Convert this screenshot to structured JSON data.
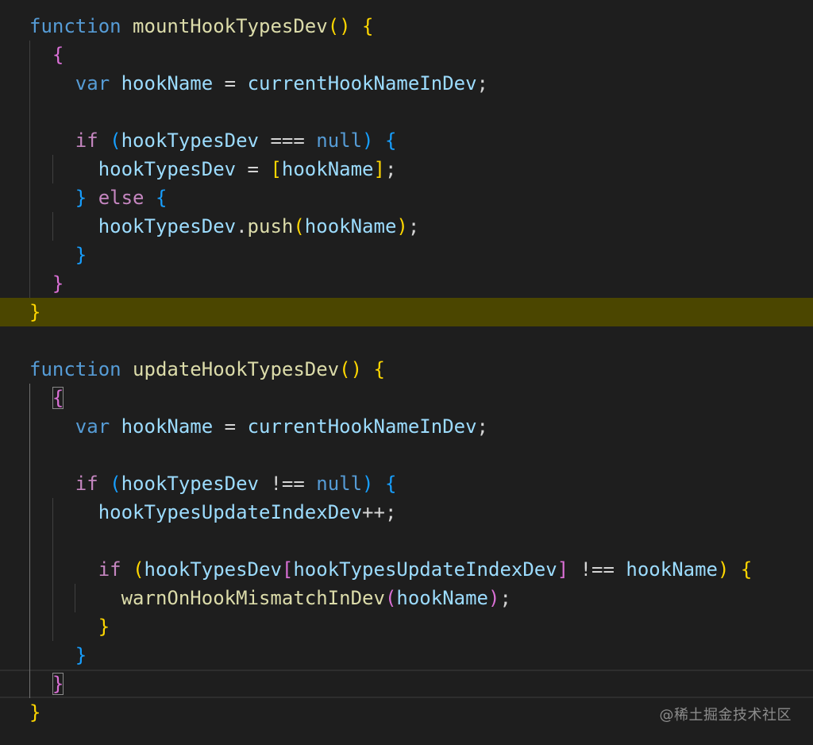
{
  "editor": {
    "colors": {
      "background": "#1e1e1e",
      "line_highlight": "#4b4600",
      "keyword": "#569cd6",
      "control": "#c586c0",
      "function": "#dcdcaa",
      "variable": "#9cdcfe",
      "bracket_gold": "#ffd700",
      "bracket_orchid": "#da70d6",
      "bracket_blue": "#179fff"
    },
    "lines": [
      {
        "tokens": [
          [
            "function",
            "kw"
          ],
          [
            " ",
            "op"
          ],
          [
            "mountHookTypesDev",
            "fn"
          ],
          [
            "()",
            "y"
          ],
          [
            " ",
            "op"
          ],
          [
            "{",
            "y"
          ]
        ]
      },
      {
        "tokens": [
          [
            "  ",
            "op"
          ],
          [
            "{",
            "p"
          ]
        ]
      },
      {
        "tokens": [
          [
            "    ",
            "op"
          ],
          [
            "var",
            "kw"
          ],
          [
            " ",
            "op"
          ],
          [
            "hookName",
            "var"
          ],
          [
            " = ",
            "op"
          ],
          [
            "currentHookNameInDev",
            "var"
          ],
          [
            ";",
            "op"
          ]
        ]
      },
      {
        "tokens": []
      },
      {
        "tokens": [
          [
            "    ",
            "op"
          ],
          [
            "if",
            "ctl"
          ],
          [
            " ",
            "op"
          ],
          [
            "(",
            "b"
          ],
          [
            "hookTypesDev",
            "var"
          ],
          [
            " === ",
            "op"
          ],
          [
            "null",
            "kw"
          ],
          [
            ")",
            "b"
          ],
          [
            " ",
            "op"
          ],
          [
            "{",
            "b"
          ]
        ]
      },
      {
        "tokens": [
          [
            "      ",
            "op"
          ],
          [
            "hookTypesDev",
            "var"
          ],
          [
            " = ",
            "op"
          ],
          [
            "[",
            "y"
          ],
          [
            "hookName",
            "var"
          ],
          [
            "]",
            "y"
          ],
          [
            ";",
            "op"
          ]
        ]
      },
      {
        "tokens": [
          [
            "    ",
            "op"
          ],
          [
            "}",
            "b"
          ],
          [
            " ",
            "op"
          ],
          [
            "else",
            "ctl"
          ],
          [
            " ",
            "op"
          ],
          [
            "{",
            "b"
          ]
        ]
      },
      {
        "tokens": [
          [
            "      ",
            "op"
          ],
          [
            "hookTypesDev",
            "var"
          ],
          [
            ".",
            "op"
          ],
          [
            "push",
            "fn"
          ],
          [
            "(",
            "y"
          ],
          [
            "hookName",
            "var"
          ],
          [
            ")",
            "y"
          ],
          [
            ";",
            "op"
          ]
        ]
      },
      {
        "tokens": [
          [
            "    ",
            "op"
          ],
          [
            "}",
            "b"
          ]
        ]
      },
      {
        "tokens": [
          [
            "  ",
            "op"
          ],
          [
            "}",
            "p"
          ]
        ]
      },
      {
        "tokens": [
          [
            "}",
            "y"
          ]
        ],
        "highlight": true
      },
      {
        "tokens": []
      },
      {
        "tokens": [
          [
            "function",
            "kw"
          ],
          [
            " ",
            "op"
          ],
          [
            "updateHookTypesDev",
            "fn"
          ],
          [
            "()",
            "y"
          ],
          [
            " ",
            "op"
          ],
          [
            "{",
            "y"
          ]
        ]
      },
      {
        "tokens": [
          [
            "  ",
            "op"
          ],
          [
            "{",
            "p",
            true
          ]
        ]
      },
      {
        "tokens": [
          [
            "    ",
            "op"
          ],
          [
            "var",
            "kw"
          ],
          [
            " ",
            "op"
          ],
          [
            "hookName",
            "var"
          ],
          [
            " = ",
            "op"
          ],
          [
            "currentHookNameInDev",
            "var"
          ],
          [
            ";",
            "op"
          ]
        ]
      },
      {
        "tokens": []
      },
      {
        "tokens": [
          [
            "    ",
            "op"
          ],
          [
            "if",
            "ctl"
          ],
          [
            " ",
            "op"
          ],
          [
            "(",
            "b"
          ],
          [
            "hookTypesDev",
            "var"
          ],
          [
            " !== ",
            "op"
          ],
          [
            "null",
            "kw"
          ],
          [
            ")",
            "b"
          ],
          [
            " ",
            "op"
          ],
          [
            "{",
            "b"
          ]
        ]
      },
      {
        "tokens": [
          [
            "      ",
            "op"
          ],
          [
            "hookTypesUpdateIndexDev",
            "var"
          ],
          [
            "++;",
            "op"
          ]
        ]
      },
      {
        "tokens": []
      },
      {
        "tokens": [
          [
            "      ",
            "op"
          ],
          [
            "if",
            "ctl"
          ],
          [
            " ",
            "op"
          ],
          [
            "(",
            "y"
          ],
          [
            "hookTypesDev",
            "var"
          ],
          [
            "[",
            "p"
          ],
          [
            "hookTypesUpdateIndexDev",
            "var"
          ],
          [
            "]",
            "p"
          ],
          [
            " !== ",
            "op"
          ],
          [
            "hookName",
            "var"
          ],
          [
            ")",
            "y"
          ],
          [
            " ",
            "op"
          ],
          [
            "{",
            "y"
          ]
        ]
      },
      {
        "tokens": [
          [
            "        ",
            "op"
          ],
          [
            "warnOnHookMismatchInDev",
            "fn"
          ],
          [
            "(",
            "p"
          ],
          [
            "hookName",
            "var"
          ],
          [
            ")",
            "p"
          ],
          [
            ";",
            "op"
          ]
        ]
      },
      {
        "tokens": [
          [
            "      ",
            "op"
          ],
          [
            "}",
            "y"
          ]
        ]
      },
      {
        "tokens": [
          [
            "    ",
            "op"
          ],
          [
            "}",
            "b"
          ]
        ]
      },
      {
        "tokens": [
          [
            "  ",
            "op"
          ],
          [
            "}",
            "p",
            true
          ]
        ],
        "current": true
      },
      {
        "tokens": [
          [
            "}",
            "y"
          ]
        ]
      }
    ]
  },
  "watermark": {
    "text": "@稀土掘金技术社区"
  }
}
